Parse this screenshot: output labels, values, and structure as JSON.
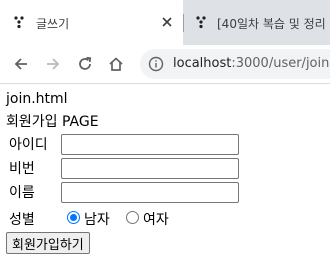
{
  "browser": {
    "tabs": [
      {
        "title": "글쓰기",
        "active": true
      },
      {
        "title": "[40일차 복습 및 정리",
        "active": false
      }
    ],
    "url_host": "localhost",
    "url_rest": ":3000/user/join"
  },
  "page": {
    "doc_name": "join.html",
    "heading": "회원가입 PAGE",
    "fields": [
      {
        "label": "아이디",
        "value": ""
      },
      {
        "label": "비번",
        "value": ""
      },
      {
        "label": "이름",
        "value": ""
      }
    ],
    "gender": {
      "label": "성별",
      "options": [
        {
          "label": "남자",
          "checked": true
        },
        {
          "label": "여자",
          "checked": false
        }
      ]
    },
    "submit_label": "회원가입하기"
  }
}
